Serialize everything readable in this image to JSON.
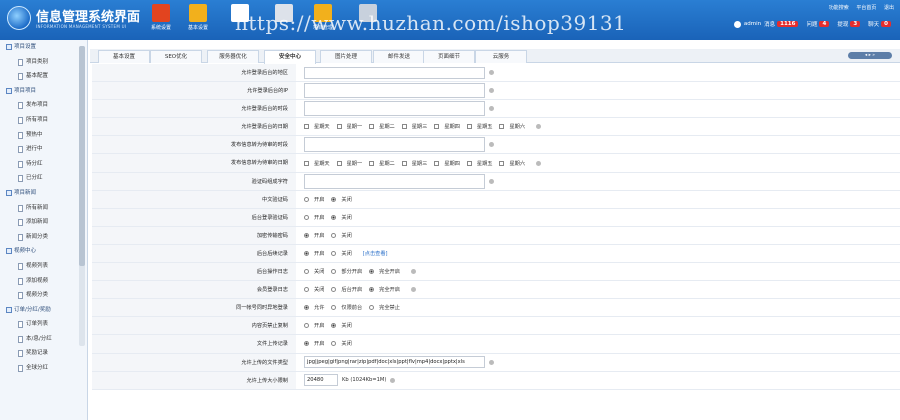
{
  "header": {
    "title": "信息管理系统界面",
    "subtitle": "INFORMATION MANAGEMENT SYSTEM UI",
    "toolbar": [
      {
        "label": "系统设置",
        "color": "#e2441f"
      },
      {
        "label": "基本设置",
        "color": "#f2b01c"
      },
      {
        "label": "",
        "color": "#ffffff"
      },
      {
        "label": "",
        "color": "#dde2ea"
      },
      {
        "label": "项目管理",
        "color": "#f2b01c"
      },
      {
        "label": "",
        "color": "#c8d1dd"
      }
    ],
    "watermark": "https://www.huzhan.com/ishop39131",
    "top_links": [
      "功能搜索",
      "平台首页",
      "退出"
    ],
    "user": {
      "name": "admin",
      "msg_label": "消息",
      "msg_count": "1116",
      "tip_label": "问题",
      "tip_count": "4",
      "mention_label": "提现",
      "mention_count": "3",
      "chat_label": "聊天",
      "chat_count": "0"
    }
  },
  "sidebar": {
    "groups": [
      {
        "label": "项目设置",
        "items": [
          "项目类别",
          "基本配置"
        ]
      },
      {
        "label": "项目项目",
        "items": [
          "发布项目",
          "所有项目",
          "预热中",
          "进行中",
          "待分红",
          "已分红"
        ]
      },
      {
        "label": "项目新闻",
        "items": [
          "所有新闻",
          "添加新闻",
          "新闻分类"
        ]
      },
      {
        "label": "视频中心",
        "items": [
          "视频列表",
          "添加视频",
          "视频分类"
        ]
      },
      {
        "label": "订单/分红/奖励",
        "items": [
          "订单列表",
          "本/息/分红",
          "奖励记录",
          "全球分红"
        ]
      }
    ]
  },
  "tabs": [
    "基本设置",
    "SEO优化",
    "服务器优化",
    "安全中心",
    "图片处理",
    "邮件发送",
    "页面细节",
    "云服务"
  ],
  "active_tab": "安全中心",
  "tab_ctrl": "◂ ▸ »",
  "form": {
    "rows": [
      {
        "label": "允许登录后台的地区",
        "type": "text",
        "value": ""
      },
      {
        "label": "允许登录后台的IP",
        "type": "bigtext",
        "value": ""
      },
      {
        "label": "允许登录后台的时段",
        "type": "bigtext",
        "value": ""
      },
      {
        "label": "允许登录后台的日期",
        "type": "checks",
        "options": [
          "星期天",
          "星期一",
          "星期二",
          "星期三",
          "星期四",
          "星期五",
          "星期六"
        ]
      },
      {
        "label": "发布信息转为待审的时段",
        "type": "bigtext",
        "value": ""
      },
      {
        "label": "发布信息转为待审的日期",
        "type": "checks",
        "options": [
          "星期天",
          "星期一",
          "星期二",
          "星期三",
          "星期四",
          "星期五",
          "星期六"
        ]
      },
      {
        "label": "验证码组成字符",
        "type": "bigtext",
        "value": ""
      },
      {
        "label": "中文验证码",
        "type": "radios",
        "options": [
          "开启",
          "关闭"
        ],
        "selected": 1
      },
      {
        "label": "后台登录验证码",
        "type": "radios",
        "options": [
          "开启",
          "关闭"
        ],
        "selected": 1
      },
      {
        "label": "加密传输密码",
        "type": "radios",
        "options": [
          "开启",
          "关闭"
        ],
        "selected": 0
      },
      {
        "label": "后台后续记录",
        "type": "radios",
        "options": [
          "开启",
          "关闭"
        ],
        "selected": 0,
        "link": "[点击查看]"
      },
      {
        "label": "后台操作日志",
        "type": "radios",
        "options": [
          "关闭",
          "部分开启",
          "完全开启"
        ],
        "selected": 2
      },
      {
        "label": "会员登录日志",
        "type": "radios",
        "options": [
          "关闭",
          "后台开启",
          "完全开启"
        ],
        "selected": 2
      },
      {
        "label": "同一帐号同时异地登录",
        "type": "radios",
        "options": [
          "允许",
          "仅限前台",
          "完全禁止"
        ],
        "selected": 0
      },
      {
        "label": "内容页禁止复制",
        "type": "radios",
        "options": [
          "开启",
          "关闭"
        ],
        "selected": 1
      },
      {
        "label": "文件上传记录",
        "type": "radios",
        "options": [
          "开启",
          "关闭"
        ],
        "selected": 0
      },
      {
        "label": "允许上传的文件类型",
        "type": "text",
        "value": "jpg|jpeg|gif|png|rar|zip|pdf|doc|xls|ppt|flv|mp4|docx|pptx|xls"
      },
      {
        "label": "允许上传大小限制",
        "type": "small",
        "value": "20480",
        "suffix": "Kb (1024Kb=1M)"
      }
    ]
  }
}
